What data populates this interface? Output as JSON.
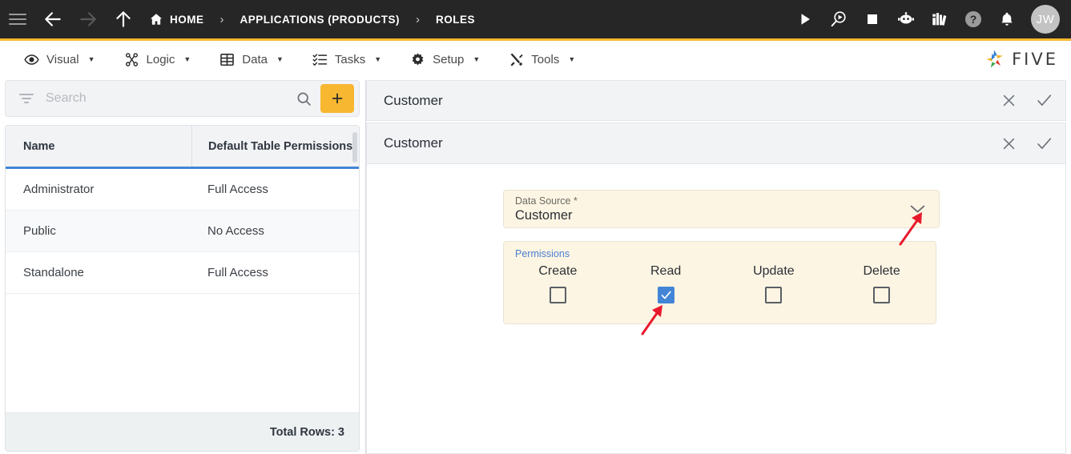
{
  "topbar": {
    "menu_icon": "hamburger-icon",
    "back_icon": "arrow-left-icon",
    "forward_icon": "arrow-right-icon",
    "up_icon": "arrow-up-icon",
    "breadcrumbs": [
      {
        "label": "HOME",
        "icon": "home-icon"
      },
      {
        "label": "APPLICATIONS (PRODUCTS)",
        "icon": ""
      },
      {
        "label": "ROLES",
        "icon": ""
      }
    ],
    "separator": "›",
    "actions": [
      {
        "name": "run-icon",
        "glyph": "play"
      },
      {
        "name": "debug-icon",
        "glyph": "magnify-play"
      },
      {
        "name": "stop-icon",
        "glyph": "square"
      },
      {
        "name": "chat-icon",
        "glyph": "chat"
      },
      {
        "name": "library-icon",
        "glyph": "books"
      },
      {
        "name": "help-icon",
        "glyph": "question"
      },
      {
        "name": "notifications-icon",
        "glyph": "bell"
      }
    ],
    "avatar_initials": "JW",
    "accent_color": "#f5b82e"
  },
  "menubar": {
    "items": [
      {
        "label": "Visual",
        "icon": "eye-icon"
      },
      {
        "label": "Logic",
        "icon": "flow-icon"
      },
      {
        "label": "Data",
        "icon": "table-icon"
      },
      {
        "label": "Tasks",
        "icon": "checklist-icon"
      },
      {
        "label": "Setup",
        "icon": "gear-icon"
      },
      {
        "label": "Tools",
        "icon": "tools-icon"
      }
    ],
    "caret": "▼",
    "brand": "FIVE"
  },
  "sidebar": {
    "search": {
      "placeholder": "Search",
      "value": "",
      "filter_icon": "filter-icon",
      "search_icon": "search-icon"
    },
    "add_button_label": "+",
    "add_button_color": "#f7b731",
    "table": {
      "columns": [
        "Name",
        "Default Table Permissions"
      ],
      "rows": [
        {
          "name": "Administrator",
          "permissions": "Full Access"
        },
        {
          "name": "Public",
          "permissions": "No Access"
        },
        {
          "name": "Standalone",
          "permissions": "Full Access"
        }
      ]
    },
    "footer": "Total Rows: 3"
  },
  "detail": {
    "outer_header": {
      "title": "Customer",
      "close_icon": "close-icon",
      "confirm_icon": "check-icon"
    },
    "inner_header": {
      "title": "Customer",
      "close_icon": "close-icon",
      "confirm_icon": "check-icon"
    },
    "data_source": {
      "label": "Data Source *",
      "value": "Customer",
      "caret_icon": "chevron-down-icon"
    },
    "permissions": {
      "legend": "Permissions",
      "options": [
        {
          "label": "Create",
          "checked": false
        },
        {
          "label": "Read",
          "checked": true
        },
        {
          "label": "Update",
          "checked": false
        },
        {
          "label": "Delete",
          "checked": false
        }
      ],
      "checked_color": "#4285d6"
    }
  },
  "annotations": {
    "arrow_color": "#e8192c",
    "items": [
      {
        "name": "arrow-to-data-source-dropdown"
      },
      {
        "name": "arrow-to-read-checkbox"
      }
    ]
  }
}
